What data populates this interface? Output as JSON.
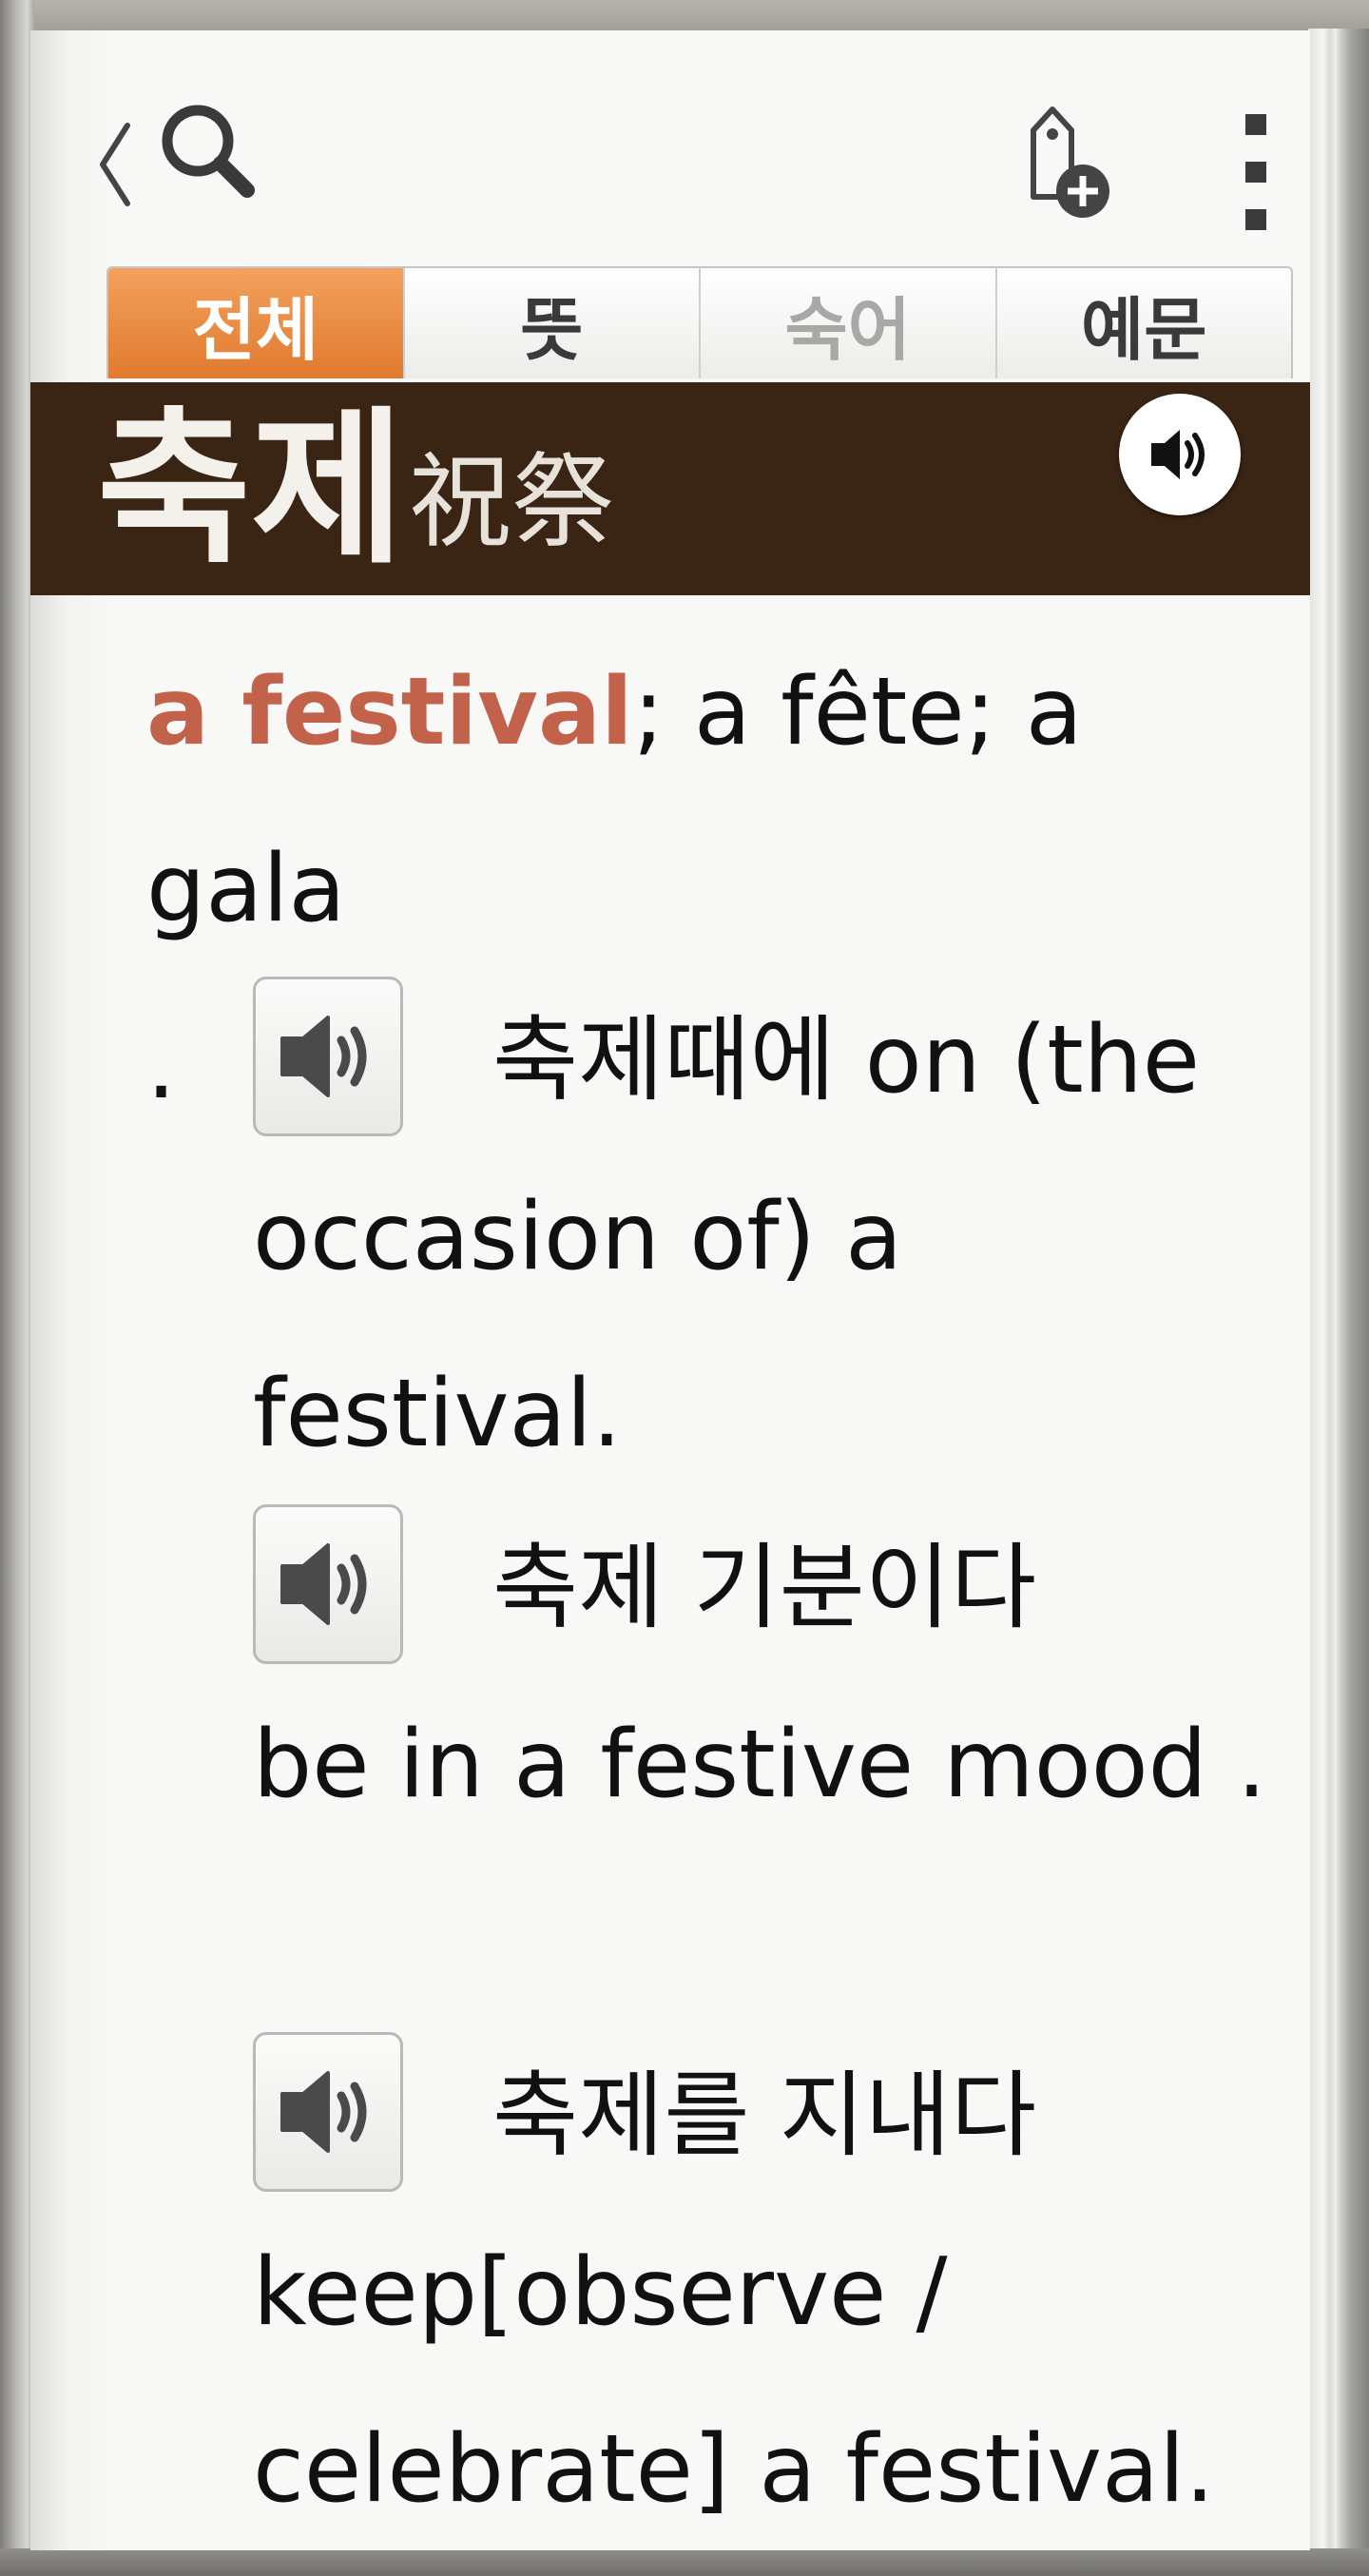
{
  "toolbar": {
    "back_icon": "chevron-left-icon",
    "search_icon": "search-icon",
    "bookmark_icon": "tag-add-icon",
    "menu_icon": "more-vertical-icon"
  },
  "tabs": [
    {
      "label": "전체",
      "state": "active"
    },
    {
      "label": "뜻",
      "state": "normal"
    },
    {
      "label": "숙어",
      "state": "disabled"
    },
    {
      "label": "예문",
      "state": "normal"
    }
  ],
  "entry": {
    "headword": "축제",
    "hanja": "祝祭",
    "pronunciation_icon": "speaker-icon",
    "definition_highlight": "a festival",
    "definition_rest": "; a fête; a gala",
    "definition_end": "."
  },
  "examples": [
    {
      "korean": "축제때에",
      "english": "on (the occasion of) a festival."
    },
    {
      "korean": "축제 기분이다",
      "english": "be in a festive mood ."
    },
    {
      "korean": "축제를 지내다",
      "english": "keep[observe / celebrate] a festival."
    }
  ],
  "colors": {
    "accent_orange": "#e9852f",
    "headword_band": "#3a2414",
    "definition_highlight": "#c3624a"
  }
}
